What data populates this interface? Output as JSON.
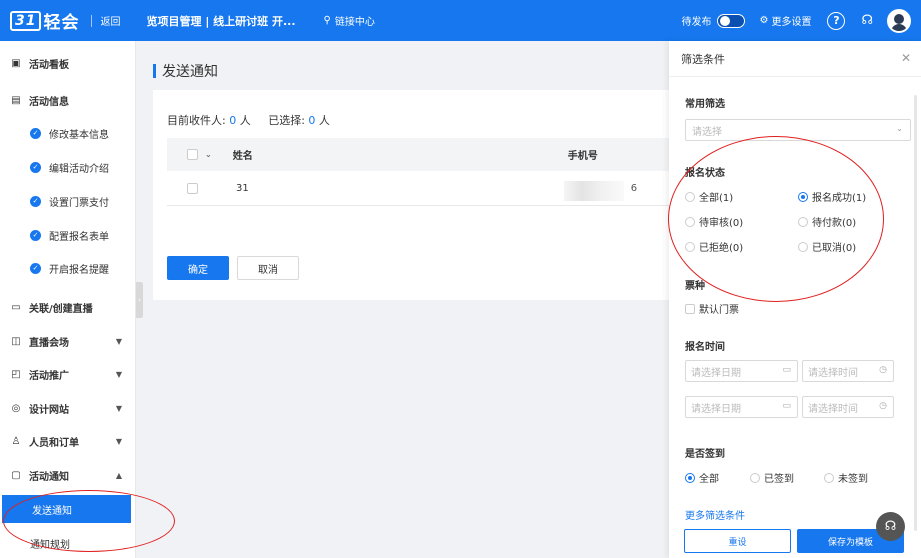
{
  "topbar": {
    "logo_mark": "31",
    "logo_text": "轻会",
    "back": "返回",
    "title": "览项目管理 | 线上研讨班 开...",
    "link_center": "链接中心",
    "pending": "待发布",
    "more_settings": "更多设置",
    "help": "?"
  },
  "sidebar": {
    "dashboard": "活动看板",
    "activity_info": "活动信息",
    "info_items": [
      "修改基本信息",
      "编辑活动介绍",
      "设置门票支付",
      "配置报名表单",
      "开启报名提醒"
    ],
    "live": "关联/创建直播",
    "live_venue": "直播会场",
    "promotion": "活动推广",
    "website": "设计网站",
    "people_orders": "人员和订单",
    "notice": "活动通知",
    "send_notice": "发送通知",
    "notice_plan": "通知规划"
  },
  "main": {
    "page_title": "发送通知",
    "recipients_label": "目前收件人:",
    "recipients_count": "0",
    "unit": "人",
    "selected_label": "已选择:",
    "selected_count": "0",
    "col_name": "姓名",
    "col_phone": "手机号",
    "row_name": "31",
    "row_phone_suffix": "6",
    "confirm": "确定",
    "cancel": "取消"
  },
  "filter": {
    "title": "筛选条件",
    "common_label": "常用筛选",
    "common_placeholder": "请选择",
    "status_label": "报名状态",
    "status_options": [
      "全部(1)",
      "报名成功(1)",
      "待审核(0)",
      "待付款(0)",
      "已拒绝(0)",
      "已取消(0)"
    ],
    "status_selected": "报名成功(1)",
    "ticket_label": "票种",
    "ticket_option": "默认门票",
    "time_label": "报名时间",
    "date_placeholder": "请选择日期",
    "time_placeholder": "请选择时间",
    "checkin_label": "是否签到",
    "checkin_options": [
      "全部",
      "已签到",
      "未签到"
    ],
    "checkin_selected": "全部",
    "more_conditions": "更多筛选条件",
    "reset": "重设",
    "save_template": "保存为模板"
  },
  "colors": {
    "primary": "#1677ee",
    "annotation": "#e02020"
  }
}
